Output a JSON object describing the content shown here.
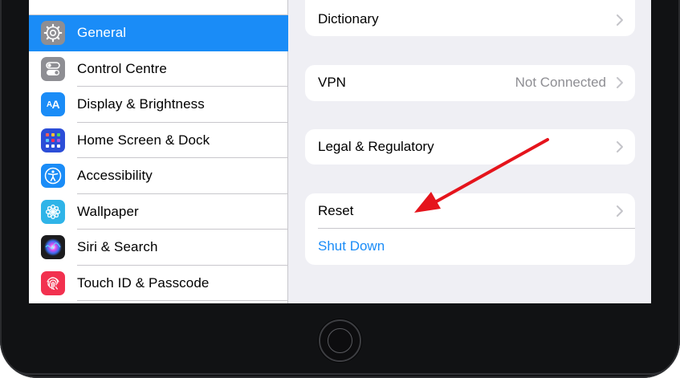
{
  "sidebar": {
    "items": [
      {
        "label": "General",
        "icon": "gear-icon",
        "color": "#8e8e93",
        "selected": true
      },
      {
        "label": "Control Centre",
        "icon": "toggles-icon",
        "color": "#8e8e93",
        "selected": false
      },
      {
        "label": "Display & Brightness",
        "icon": "text-size-icon",
        "color": "#1a8cf7",
        "selected": false
      },
      {
        "label": "Home Screen & Dock",
        "icon": "app-grid-icon",
        "color": "#2c4ed8",
        "selected": false
      },
      {
        "label": "Accessibility",
        "icon": "accessibility-icon",
        "color": "#1a8cf7",
        "selected": false
      },
      {
        "label": "Wallpaper",
        "icon": "flower-icon",
        "color": "#2fb4e8",
        "selected": false
      },
      {
        "label": "Siri & Search",
        "icon": "siri-icon",
        "color": "#1c1c1e",
        "selected": false
      },
      {
        "label": "Touch ID & Passcode",
        "icon": "fingerprint-icon",
        "color": "#f2314f",
        "selected": false
      }
    ]
  },
  "detail": {
    "dictionary": {
      "label": "Dictionary"
    },
    "vpn": {
      "label": "VPN",
      "value": "Not Connected"
    },
    "legal": {
      "label": "Legal & Regulatory"
    },
    "reset": {
      "label": "Reset"
    },
    "shutdown": {
      "label": "Shut Down"
    }
  },
  "colors": {
    "accent": "#1a8cf7",
    "annotation_arrow": "#e5141c"
  }
}
